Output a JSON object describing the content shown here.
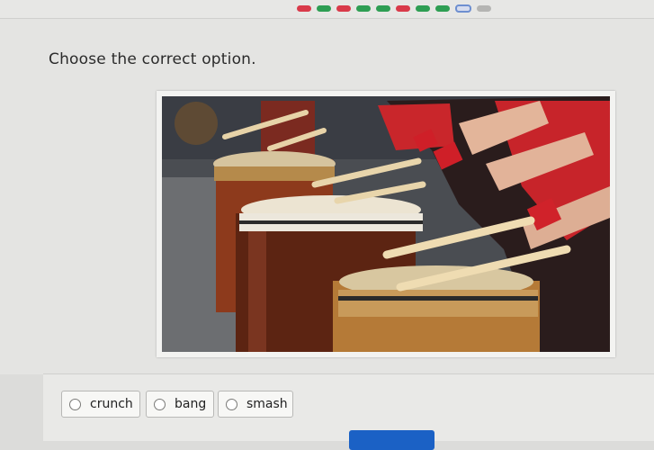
{
  "progress": {
    "segments": [
      {
        "color": "#d93a4a"
      },
      {
        "color": "#2e9e53"
      },
      {
        "color": "#d93a4a"
      },
      {
        "color": "#2e9e53"
      },
      {
        "color": "#2e9e53"
      },
      {
        "color": "#d93a4a"
      },
      {
        "color": "#2e9e53"
      },
      {
        "color": "#2e9e53"
      },
      {
        "color": "#d6dcee",
        "current": true
      },
      {
        "color": "#b5b5b3"
      }
    ],
    "completed_count": 8,
    "total_count": 10
  },
  "question": {
    "prompt": "Choose the correct option."
  },
  "image": {
    "subject": "taiko drums being struck with wooden sticks by drummers in red"
  },
  "answers": {
    "options": [
      {
        "label": "crunch"
      },
      {
        "label": "bang"
      },
      {
        "label": "smash"
      }
    ]
  },
  "colors": {
    "accent": "#1b61c5",
    "correct": "#2e9e53",
    "incorrect": "#d93a4a"
  }
}
